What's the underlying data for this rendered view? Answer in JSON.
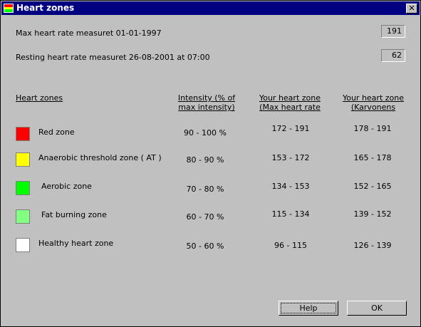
{
  "window": {
    "title": "Heart zones",
    "close_glyph": "✕",
    "icon_colors": [
      "#ff0000",
      "#ffff00",
      "#00ff00"
    ]
  },
  "measurements": [
    {
      "label": "Max heart rate measuret 01-01-1997",
      "value": "191"
    },
    {
      "label": "Resting heart rate measuret 26-08-2001 at 07:00",
      "value": "62"
    }
  ],
  "table": {
    "headers": {
      "zones": "Heart zones",
      "intensity": "Intensity   (% of max intensity)",
      "max_hr": "Your heart zone (Max  heart rate",
      "karvonen": "Your heart zone (Karvonens"
    },
    "rows": [
      {
        "name": "Red zone",
        "color": "#ff0000",
        "intensity": "90 - 100 %",
        "max_hr": "172 - 191",
        "karvonen": "178 - 191"
      },
      {
        "name": "Anaerobic threshold zone ( AT )",
        "color": "#ffff00",
        "intensity": "80 - 90 %",
        "max_hr": "153 - 172",
        "karvonen": "165 - 178"
      },
      {
        "name": "Aerobic zone",
        "color": "#00ff00",
        "intensity": "70 - 80 %",
        "max_hr": "134 - 153",
        "karvonen": "152 - 165"
      },
      {
        "name": "Fat burning zone",
        "color": "#80ff80",
        "intensity": "60 - 70 %",
        "max_hr": "115 - 134",
        "karvonen": "139 - 152"
      },
      {
        "name": "Healthy heart zone",
        "color": "#ffffff",
        "intensity": "50 - 60 %",
        "max_hr": "96 - 115",
        "karvonen": "126 - 139"
      }
    ]
  },
  "buttons": {
    "help": "Help",
    "ok": "OK"
  }
}
